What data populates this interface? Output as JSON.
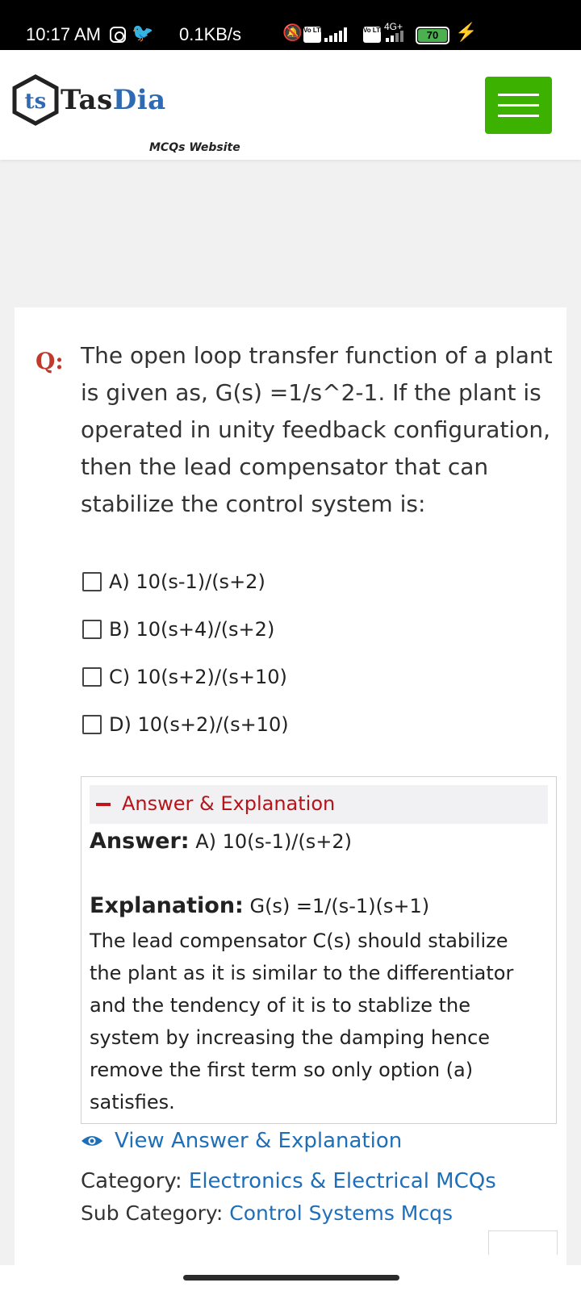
{
  "status_bar": {
    "time": "10:17 AM",
    "speed": "0.1KB/s",
    "lte_label": "Vo LTE",
    "network": "4G+",
    "battery": "70"
  },
  "header": {
    "logo_badge": "ts",
    "logo_name_prefix": "Tas",
    "logo_name_suffix": "Dia",
    "tagline": "MCQs Website",
    "accent_color": "#3cb100"
  },
  "question": {
    "label": "Q:",
    "text": "The open loop transfer function of a plant is given as, G(s) =1/s^2-1. If the plant is operated in unity feedback configuration, then the lead compensator that can stabilize the control system is:",
    "options": [
      "A) 10(s-1)/(s+2)",
      "B) 10(s+4)/(s+2)",
      "C) 10(s+2)/(s+10)",
      "D) 10(s+2)/(s+10)"
    ]
  },
  "answer": {
    "header": "Answer & Explanation",
    "answer_label": "Answer:",
    "answer_value": " A) 10(s-1)/(s+2)",
    "explanation_label": "Explanation:",
    "explanation_value": " G(s) =1/(s-1)(s+1)",
    "explanation_body": "The lead compensator C(s) should stabilize the plant as it is similar to the differentiator and the tendency of it is to stablize the system by increasing the damping hence remove the first term so only option (a) satisfies."
  },
  "view_answer_label": "View Answer & Explanation",
  "category": {
    "label": "Category: ",
    "value": "Electronics & Electrical MCQs"
  },
  "sub_category": {
    "label": "Sub Category: ",
    "value": "Control Systems Mcqs"
  }
}
